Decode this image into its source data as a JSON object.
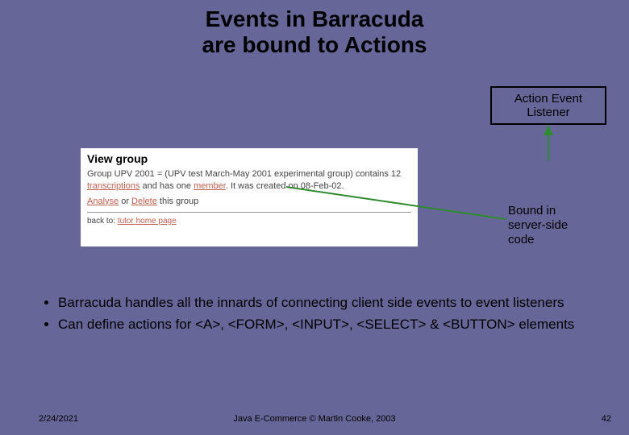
{
  "title_line1": "Events in Barracuda",
  "title_line2": "are bound to Actions",
  "callout": "Action Event Listener",
  "screenshot": {
    "heading": "View group",
    "body_prefix": "Group UPV 2001 = (UPV test March-May 2001 experimental group) contains 12 ",
    "link_transcriptions": "transcriptions",
    "body_mid": " and has one ",
    "link_member": "member",
    "body_suffix": ". It was created on 08-Feb-02.",
    "link_analyse": "Analyse",
    "row2_mid": " or ",
    "link_delete": "Delete",
    "row2_suffix": " this group",
    "back_prefix": "back to: ",
    "link_back": "tutor home page"
  },
  "bound_label_l1": "Bound in",
  "bound_label_l2": "server-side",
  "bound_label_l3": "code",
  "bullets": [
    "Barracuda handles all the innards of connecting client side events to event listeners",
    "Can define actions for <A>, <FORM>, <INPUT>, <SELECT> & <BUTTON> elements"
  ],
  "footer_date": "2/24/2021",
  "footer_center": "Java E-Commerce © Martin Cooke, 2003",
  "footer_num": "42"
}
